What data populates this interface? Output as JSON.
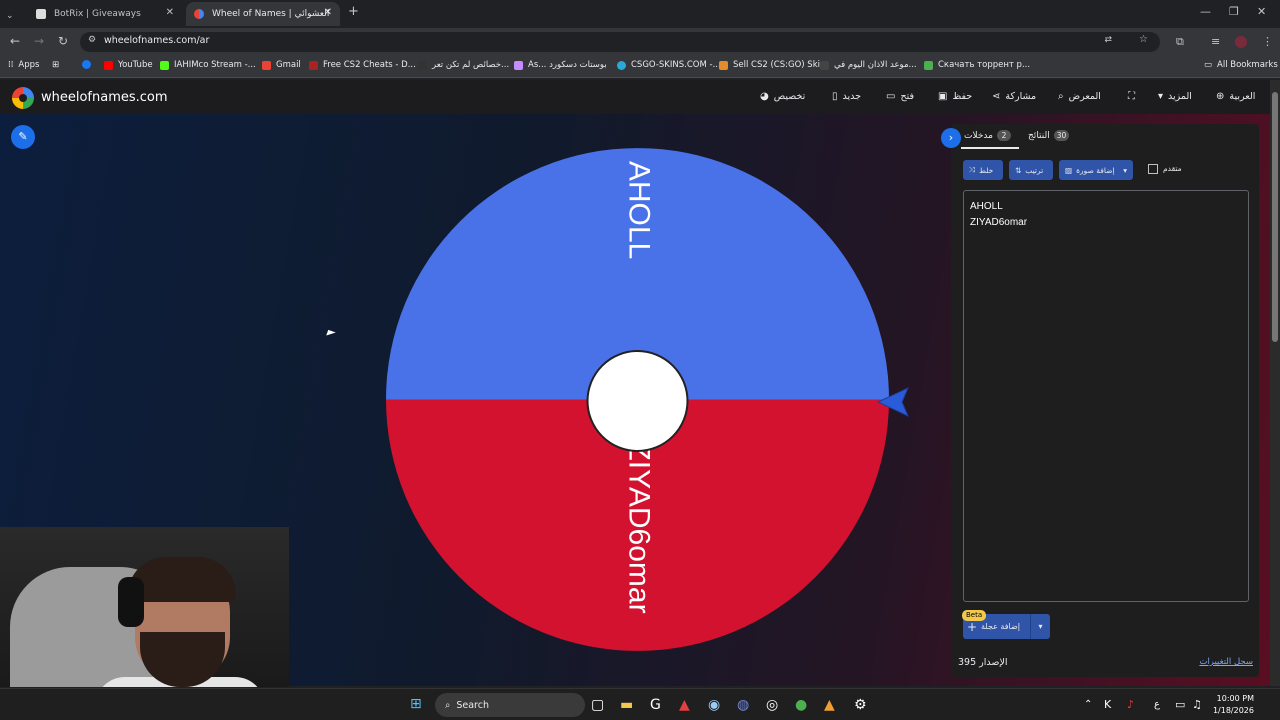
{
  "browser": {
    "tabs": [
      {
        "title": "BotRix | Giveaways",
        "active": false
      },
      {
        "title": "Wheel of Names | عجلة الأسماء العشوائية - اسم العشوائي",
        "active": true
      }
    ],
    "url": "wheelofnames.com/ar",
    "bookmarks": [
      "Apps",
      "YouTube",
      "IAHIMco Stream -...",
      "Gmail",
      "Free CS2 Cheats - D...",
      "خصائص لم تكن تعر...",
      "As... بوستات دسكورد",
      "CSGO-SKINS.COM -...",
      "Sell CS2 (CS:GO) Ski...",
      "موعد الاذان اليوم في...",
      "Скачать торрент р...",
      "All Bookmarks"
    ]
  },
  "app": {
    "brand": "wheelofnames.com",
    "menu": [
      {
        "label": "تخصيص",
        "icon": "palette-icon"
      },
      {
        "label": "جديد",
        "icon": "file-icon"
      },
      {
        "label": "فتح",
        "icon": "folder-icon"
      },
      {
        "label": "حفظ",
        "icon": "save-icon"
      },
      {
        "label": "مشاركة",
        "icon": "share-icon"
      },
      {
        "label": "المعرض",
        "icon": "search-icon"
      },
      {
        "label": "",
        "icon": "fullscreen-icon"
      },
      {
        "label": "المزيد",
        "icon": "chevron-down-icon"
      },
      {
        "label": "العربية",
        "icon": "globe-icon"
      }
    ]
  },
  "wheel": {
    "segments": [
      {
        "name": "AHOLL",
        "color": "#4a72e8"
      },
      {
        "name": "ZIYAD6omar",
        "color": "#d3122f"
      }
    ]
  },
  "panel": {
    "tab_entries": {
      "label": "مدخلات",
      "count": "2"
    },
    "tab_results": {
      "label": "النتائج",
      "count": "30"
    },
    "shuffle": "خلط",
    "sort": "ترتيب",
    "add_image": "إضافة صورة",
    "advanced": "متقدم",
    "entries": [
      "AHOLL",
      "ZIYAD6omar"
    ],
    "beta": "Beta",
    "add_wheel": "إضافة عجلة",
    "version_label": "الإصدار",
    "version_number": "395",
    "changelog": "سجل التغييرات"
  },
  "taskbar": {
    "search": "Search",
    "time": "10:00 PM",
    "date": "1/18/2026",
    "lang": "ع"
  }
}
